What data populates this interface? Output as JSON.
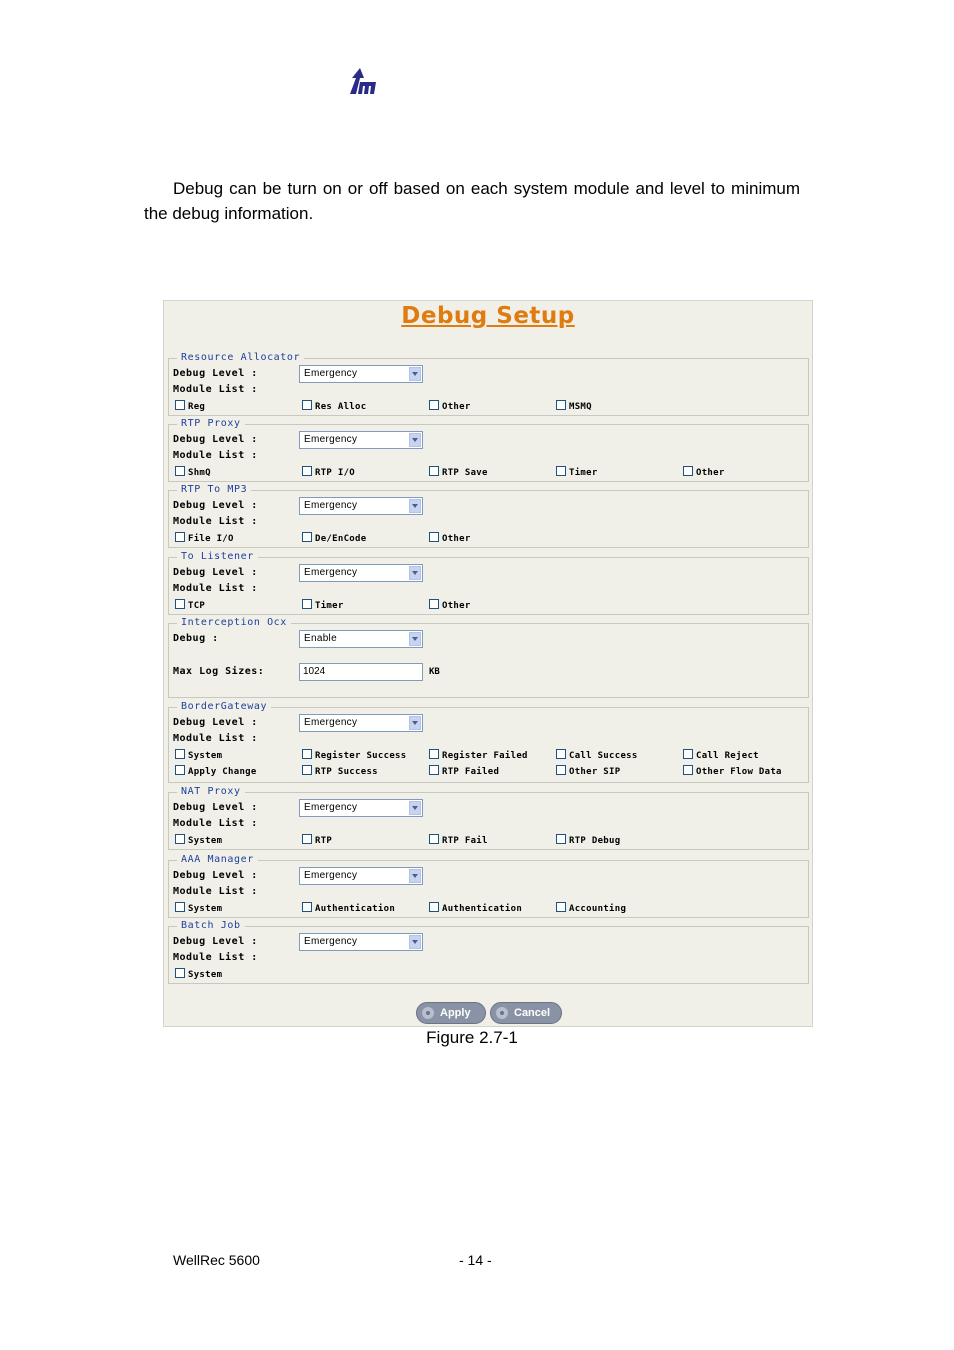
{
  "header": {
    "logo_icon": "company-logo-icon"
  },
  "intro_text": "Debug can be turn on or off based on each system module and level to minimum the debug information.",
  "debug_setup": {
    "title": "Debug Setup",
    "labels": {
      "debug_level": "Debug Level :",
      "module_list": "Module List :",
      "debug": "Debug :",
      "max_log_sizes": "Max Log Sizes:",
      "kb": "KB"
    },
    "groups": [
      {
        "legend": "Resource Allocator",
        "level": "Emergency",
        "modules": [
          "Reg",
          "Res Alloc",
          "Other",
          "MSMQ"
        ]
      },
      {
        "legend": "RTP Proxy",
        "level": "Emergency",
        "modules": [
          "ShmQ",
          "RTP I/O",
          "RTP Save",
          "Timer",
          "Other"
        ]
      },
      {
        "legend": "RTP To MP3",
        "level": "Emergency",
        "modules": [
          "File I/O",
          "De/EnCode",
          "Other"
        ]
      },
      {
        "legend": "To Listener",
        "level": "Emergency",
        "modules": [
          "TCP",
          "Timer",
          "Other"
        ]
      },
      {
        "legend": "Interception Ocx",
        "debug": "Enable",
        "max_log_size": "1024"
      },
      {
        "legend": "BorderGateway",
        "level": "Emergency",
        "modules": [
          "System",
          "Register Success",
          "Register Failed",
          "Call Success",
          "Call Reject",
          "Apply Change",
          "RTP Success",
          "RTP Failed",
          "Other SIP",
          "Other Flow Data"
        ]
      },
      {
        "legend": "NAT Proxy",
        "level": "Emergency",
        "modules": [
          "System",
          "RTP",
          "RTP Fail",
          "RTP Debug"
        ]
      },
      {
        "legend": "AAA Manager",
        "level": "Emergency",
        "modules": [
          "System",
          "Authentication",
          "Authentication",
          "Accounting"
        ]
      },
      {
        "legend": "Batch Job",
        "level": "Emergency",
        "modules": [
          "System"
        ]
      }
    ],
    "buttons": {
      "apply": "Apply",
      "cancel": "Cancel"
    }
  },
  "caption": "Figure 2.7-1",
  "footer": {
    "product": "WellRec 5600",
    "page": "- 14 -"
  },
  "colors": {
    "title": "#e07b10",
    "legend": "#1f3e9c",
    "panel_bg": "#f0f0e8"
  }
}
